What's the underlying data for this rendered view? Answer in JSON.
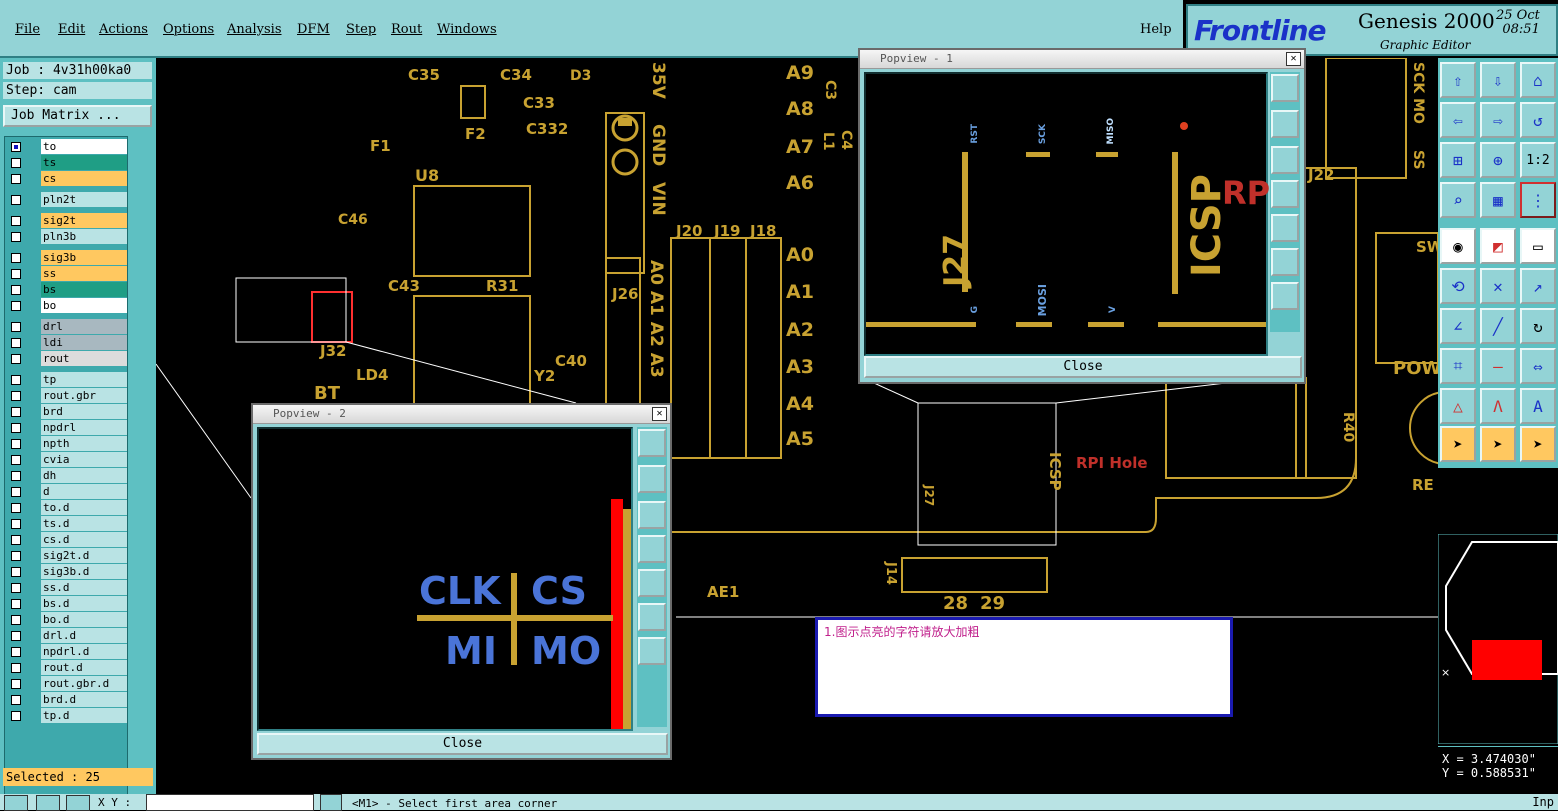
{
  "menu": [
    "File",
    "Edit",
    "Actions",
    "Options",
    "Analysis",
    "DFM",
    "Step",
    "Rout",
    "Windows"
  ],
  "help": "Help",
  "brand": {
    "logo": "Frontline",
    "product": "Genesis 2000",
    "subtitle": "Graphic Editor",
    "date": "25 Oct",
    "time": "08:51"
  },
  "job": "Job : 4v31h00ka0",
  "step": "Step: cam",
  "job_matrix": "Job Matrix ...",
  "layers": [
    {
      "name": "to",
      "checked": true,
      "color": "#ffffff"
    },
    {
      "name": "ts",
      "checked": false,
      "color": "#1f9e85"
    },
    {
      "name": "cs",
      "checked": false,
      "color": "#ffc860"
    },
    {
      "name": "pln2t",
      "checked": false,
      "color": "#b9e3e4"
    },
    {
      "name": "sig2t",
      "checked": false,
      "color": "#ffc860"
    },
    {
      "name": "pln3b",
      "checked": false,
      "color": "#b9e3e4"
    },
    {
      "name": "sig3b",
      "checked": false,
      "color": "#ffc860"
    },
    {
      "name": "ss",
      "checked": false,
      "color": "#ffc860"
    },
    {
      "name": "bs",
      "checked": false,
      "color": "#1f9e85"
    },
    {
      "name": "bo",
      "checked": false,
      "color": "#ffffff"
    },
    {
      "name": "drl",
      "checked": false,
      "color": "#a8b8c0"
    },
    {
      "name": "ldi",
      "checked": false,
      "color": "#a8b8c0"
    },
    {
      "name": "rout",
      "checked": false,
      "color": "#dcdcdc"
    },
    {
      "name": "tp",
      "checked": false,
      "color": "#b9e3e4"
    },
    {
      "name": "rout.gbr",
      "checked": false,
      "color": "#b9e3e4"
    },
    {
      "name": "brd",
      "checked": false,
      "color": "#b9e3e4"
    },
    {
      "name": "npdrl",
      "checked": false,
      "color": "#b9e3e4"
    },
    {
      "name": "npth",
      "checked": false,
      "color": "#b9e3e4"
    },
    {
      "name": "cvia",
      "checked": false,
      "color": "#b9e3e4"
    },
    {
      "name": "dh",
      "checked": false,
      "color": "#b9e3e4"
    },
    {
      "name": "d",
      "checked": false,
      "color": "#b9e3e4"
    },
    {
      "name": "to.d",
      "checked": false,
      "color": "#b9e3e4"
    },
    {
      "name": "ts.d",
      "checked": false,
      "color": "#b9e3e4"
    },
    {
      "name": "cs.d",
      "checked": false,
      "color": "#b9e3e4"
    },
    {
      "name": "sig2t.d",
      "checked": false,
      "color": "#b9e3e4"
    },
    {
      "name": "sig3b.d",
      "checked": false,
      "color": "#b9e3e4"
    },
    {
      "name": "ss.d",
      "checked": false,
      "color": "#b9e3e4"
    },
    {
      "name": "bs.d",
      "checked": false,
      "color": "#b9e3e4"
    },
    {
      "name": "bo.d",
      "checked": false,
      "color": "#b9e3e4"
    },
    {
      "name": "drl.d",
      "checked": false,
      "color": "#b9e3e4"
    },
    {
      "name": "npdrl.d",
      "checked": false,
      "color": "#b9e3e4"
    },
    {
      "name": "rout.d",
      "checked": false,
      "color": "#b9e3e4"
    },
    {
      "name": "rout.gbr.d",
      "checked": false,
      "color": "#b9e3e4"
    },
    {
      "name": "brd.d",
      "checked": false,
      "color": "#b9e3e4"
    },
    {
      "name": "tp.d",
      "checked": false,
      "color": "#b9e3e4"
    }
  ],
  "selected": "Selected : 25",
  "popview1": {
    "title": "Popview - 1",
    "close": "Close"
  },
  "popview2": {
    "title": "Popview - 2",
    "close": "Close"
  },
  "message": "1.图示点亮的字符请放大加粗",
  "coords": {
    "x": "X = 3.474030\"",
    "y": "Y = 0.588531\""
  },
  "status": {
    "xy_label": "X Y :",
    "prompt": "<M1> - Select first area corner",
    "right": "Inp"
  },
  "canvas_labels": [
    "C35",
    "C34",
    "C33",
    "C332",
    "F1",
    "F2",
    "U8",
    "C46",
    "C43",
    "R31",
    "J32",
    "LD4",
    "BT",
    "J26",
    "Y2",
    "C40",
    "D3",
    "35V",
    "GND",
    "VIN",
    "J20",
    "J19",
    "J18",
    "A9",
    "A8",
    "A7",
    "A6",
    "A0",
    "A1",
    "A2",
    "A3",
    "A4",
    "A5",
    "A0 A1 A2 A3",
    "AE1",
    "J14",
    "28",
    "29",
    "ICSP",
    "J27",
    "RPI Hole",
    "J22",
    "POW",
    "RE",
    "SW",
    "SCK MO",
    "R40",
    "C3",
    "C4",
    "L1",
    "SS"
  ],
  "zoom2_labels": [
    "CLK",
    "CS",
    "MI",
    "MO"
  ],
  "zoom1_labels": [
    "J27",
    "ICSP",
    "RST",
    "SCK",
    "MISO",
    "MOSI",
    "G",
    "V",
    "RP"
  ]
}
